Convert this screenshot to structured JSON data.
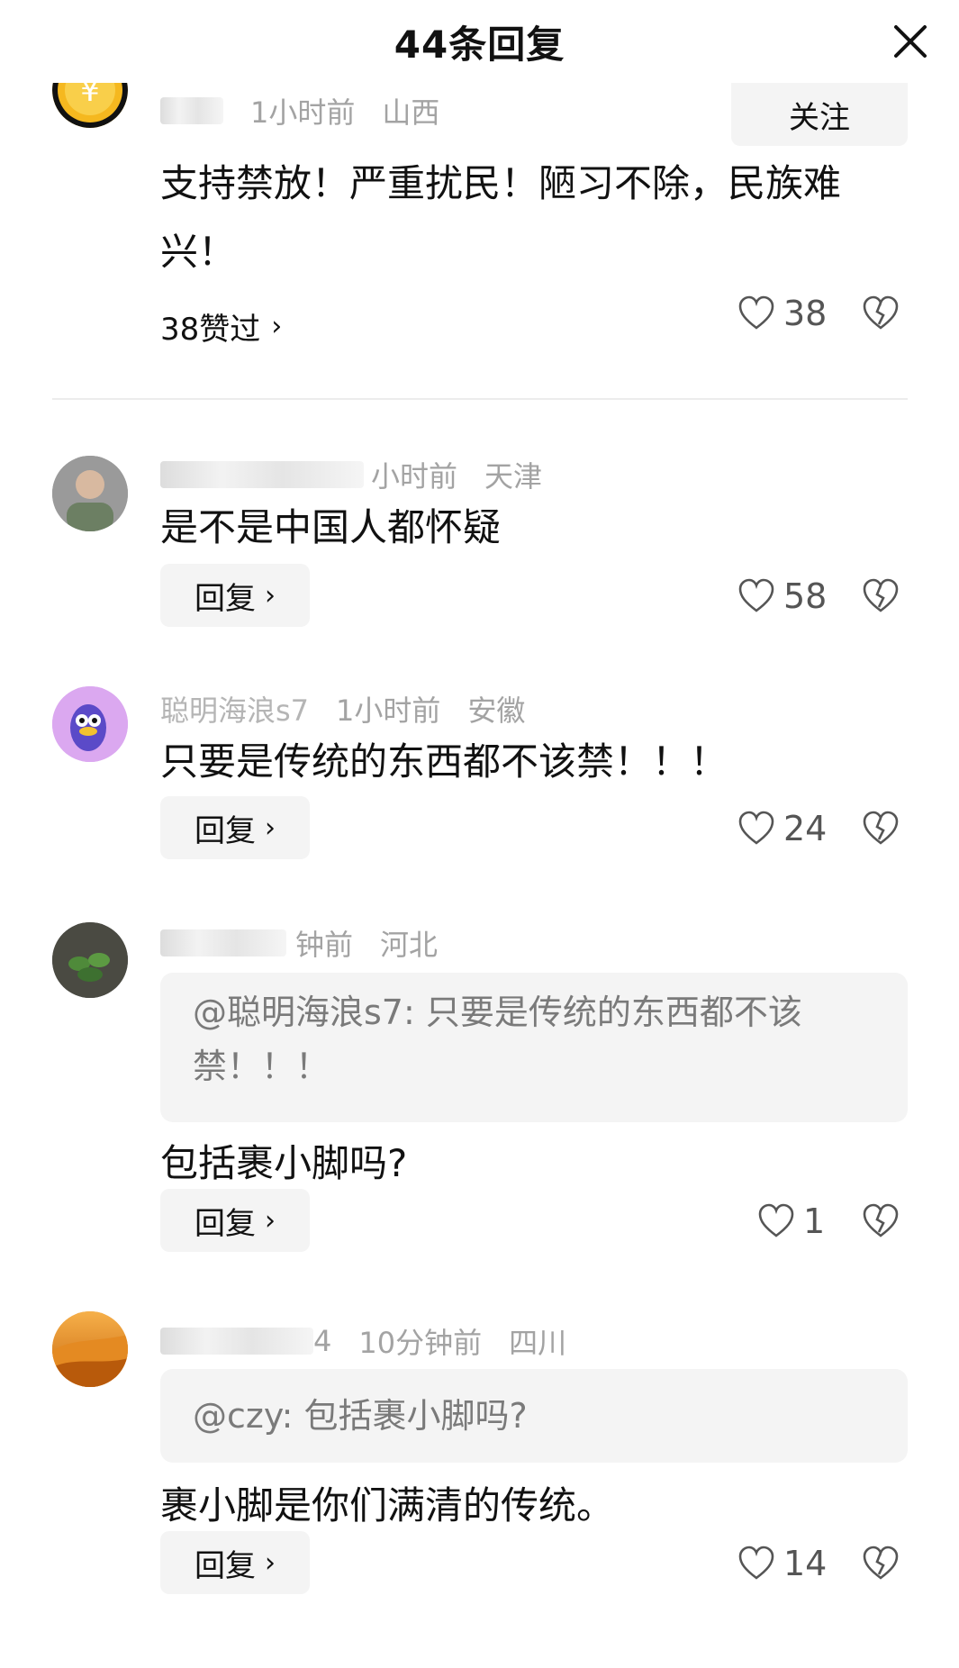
{
  "header": {
    "title": "44条回复"
  },
  "comments": [
    {
      "name": "",
      "time": "1小时前",
      "location": "山西",
      "follow_label": "关注",
      "text": "支持禁放！严重扰民！陋习不除，民族难兴！",
      "likes_link": "38赞过",
      "likes": "38"
    },
    {
      "name": "",
      "time": "小时前",
      "location": "天津",
      "text": "是不是中国人都怀疑",
      "reply_label": "回复",
      "likes": "58"
    },
    {
      "name": "聪明海浪s7",
      "time": "1小时前",
      "location": "安徽",
      "text": "只要是传统的东西都不该禁！！！",
      "reply_label": "回复",
      "likes": "24"
    },
    {
      "name": "",
      "time": "钟前",
      "location": "河北",
      "quote": "@聪明海浪s7: 只要是传统的东西都不该禁！！！",
      "text": "包括裹小脚吗?",
      "reply_label": "回复",
      "likes": "1"
    },
    {
      "name": "4",
      "time": "10分钟前",
      "location": "四川",
      "quote": "@czy: 包括裹小脚吗?",
      "text": "裹小脚是你们满清的传统。",
      "reply_label": "回复",
      "likes": "14"
    }
  ],
  "icons": {
    "close": "close-icon",
    "like": "heart-outline-icon",
    "dislike": "broken-heart-icon"
  }
}
